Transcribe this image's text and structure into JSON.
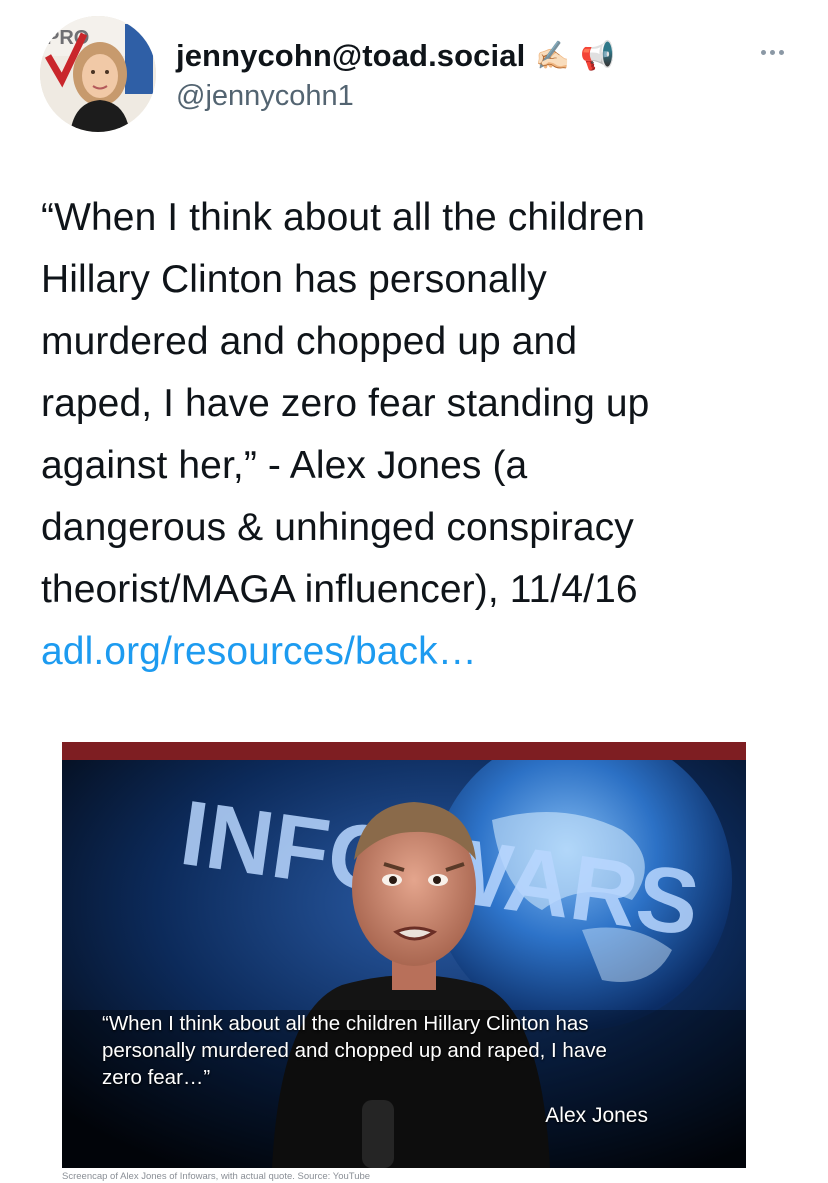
{
  "tweet": {
    "author": {
      "display_name": "jennycohn@toad.social",
      "emojis": [
        "✍🏻",
        "📢"
      ],
      "handle": "@jennycohn1",
      "avatar_badge_text": "PRO"
    },
    "more_icon": "more-horizontal-icon",
    "text_lines": [
      "“When I think about all the children",
      "Hillary Clinton has personally",
      "murdered and chopped up and",
      "raped, I have zero fear standing up",
      "against her,” - Alex Jones (a",
      "dangerous & unhinged conspiracy",
      "theorist/MAGA influencer), 11/4/16"
    ],
    "link_text": "adl.org/resources/back…",
    "media": {
      "background_text": "INFO WARS",
      "caption_lines": [
        "“When I think about all the children Hillary Clinton has",
        "personally murdered and chopped up and raped, I have",
        "zero fear…”"
      ],
      "caption_attribution": "Alex Jones",
      "source_note": "Screencap of Alex Jones of Infowars, with actual quote. Source: YouTube"
    }
  },
  "colors": {
    "link": "#1d9bf0",
    "text": "#0f1419",
    "secondary": "#536471",
    "media_topbar": "#7e1e22"
  }
}
